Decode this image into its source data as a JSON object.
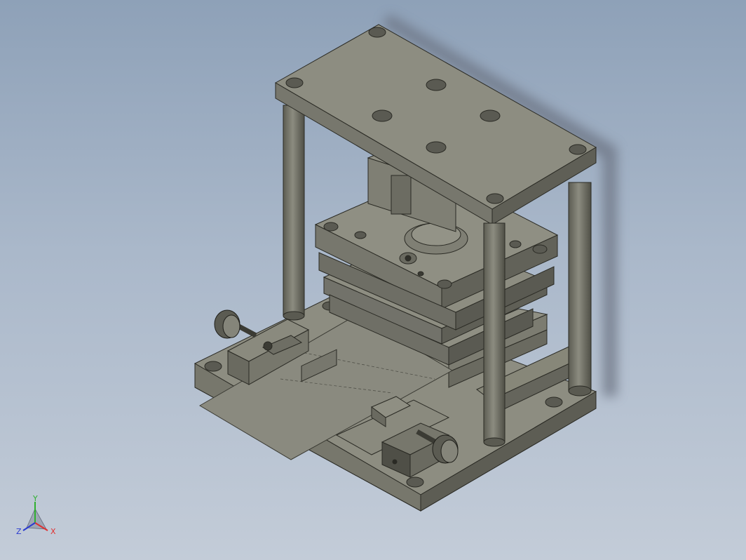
{
  "view": {
    "background_top": "#8ea1b8",
    "background_bottom": "#c3ccd8"
  },
  "model": {
    "components": [
      "top-die-plate",
      "guide-pillars",
      "punch-holder",
      "stripper-plate",
      "die-plate",
      "die-set-base",
      "strip-guide-rails",
      "sheet-strip",
      "adjustment-knobs",
      "shank"
    ]
  },
  "triad": {
    "x_label": "X",
    "y_label": "Y",
    "z_label": "Z",
    "x_color": "#e03030",
    "y_color": "#2fb02f",
    "z_color": "#2a3ad0"
  }
}
